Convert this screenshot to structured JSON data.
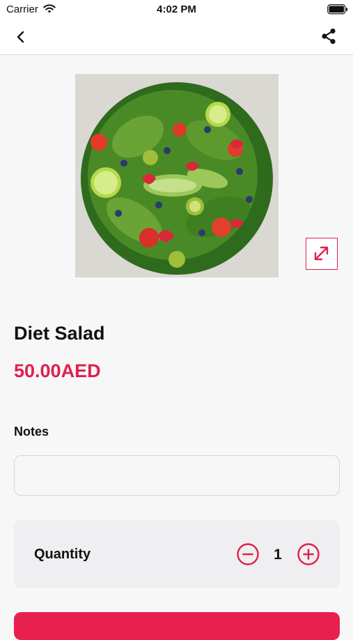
{
  "status_bar": {
    "carrier": "Carrier",
    "time": "4:02 PM"
  },
  "nav": {
    "back_icon": "chevron-left-icon",
    "share_icon": "share-icon"
  },
  "product": {
    "image_alt": "salad-photo",
    "name": "Diet Salad",
    "price": "50.00AED",
    "expand_icon": "expand-arrows-icon"
  },
  "notes": {
    "label": "Notes",
    "value": "",
    "placeholder": ""
  },
  "quantity": {
    "label": "Quantity",
    "value": "1",
    "minus_icon": "minus-circle-icon",
    "plus_icon": "plus-circle-icon"
  },
  "colors": {
    "accent": "#e0204e",
    "background": "#f7f7f8",
    "card": "#efeff1"
  }
}
